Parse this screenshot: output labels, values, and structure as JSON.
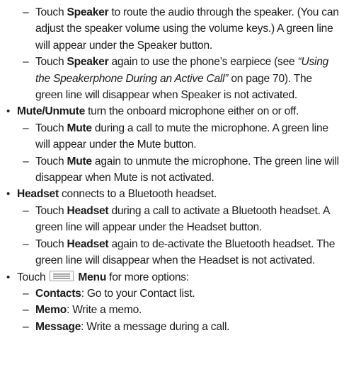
{
  "dash": "–",
  "bullet_dot": "•",
  "speaker": {
    "item1": {
      "pre": "Touch ",
      "bold": "Speaker",
      "post": " to route the audio through the speaker. (You can adjust the speaker volume using the volume keys.) A green line will appear under the Speaker button."
    },
    "item2": {
      "pre": "Touch ",
      "bold": "Speaker",
      "mid": " again to use the phone’s earpiece (see ",
      "italic": "“Using the Speakerphone During an Active Call”",
      "post": " on page 70). The green line will disappear when Speaker is not activated."
    }
  },
  "mute": {
    "bold": "Mute/Unmute",
    "text": " turn the onboard microphone either on or off.",
    "item1": {
      "pre": "Touch ",
      "bold": "Mute",
      "post": " during a call to mute the microphone. A green line will appear under the Mute button."
    },
    "item2": {
      "pre": "Touch ",
      "bold": "Mute",
      "post": " again to unmute the microphone. The green line will disappear when Mute is not activated."
    }
  },
  "headset": {
    "bold": "Headset",
    "text": " connects to a Bluetooth headset.",
    "item1": {
      "pre": "Touch ",
      "bold": "Headset",
      "post": " during a call to activate a Bluetooth headset. A green line will appear under the Headset button."
    },
    "item2": {
      "pre": "Touch ",
      "bold": "Headset",
      "post": " again to de-activate the Bluetooth headset. The green line will disappear when the Headset is not activated."
    }
  },
  "menu": {
    "pre": "Touch",
    "icon": "menu-icon",
    "bold": "Menu",
    "post": " for more options:",
    "items": [
      {
        "bold": "Contacts",
        "text": ": Go to your Contact list."
      },
      {
        "bold": "Memo",
        "text": ": Write a memo."
      },
      {
        "bold": "Message",
        "text": ": Write a message during a call."
      }
    ]
  }
}
